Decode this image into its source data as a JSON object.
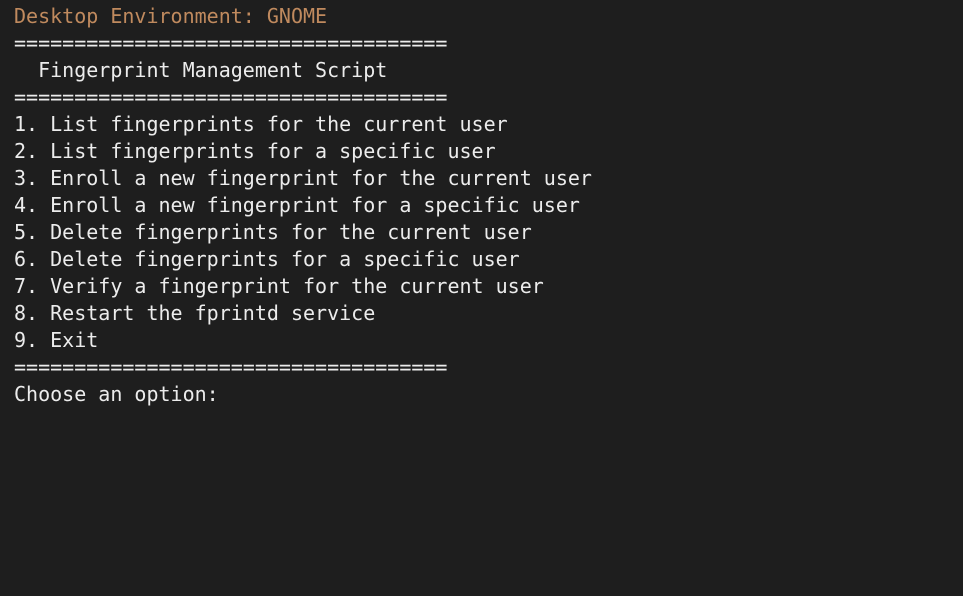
{
  "terminal": {
    "env_line": "Desktop Environment: GNOME",
    "separator": "====================================",
    "title": "  Fingerprint Management Script",
    "menu": [
      "1. List fingerprints for the current user",
      "2. List fingerprints for a specific user",
      "3. Enroll a new fingerprint for the current user",
      "4. Enroll a new fingerprint for a specific user",
      "5. Delete fingerprints for the current user",
      "6. Delete fingerprints for a specific user",
      "7. Verify a fingerprint for the current user",
      "8. Restart the fprintd service",
      "9. Exit"
    ],
    "prompt": "Choose an option: ",
    "input_value": ""
  },
  "colors": {
    "background": "#1e1e1e",
    "text": "#ececec",
    "env_text": "#c08a5e"
  }
}
